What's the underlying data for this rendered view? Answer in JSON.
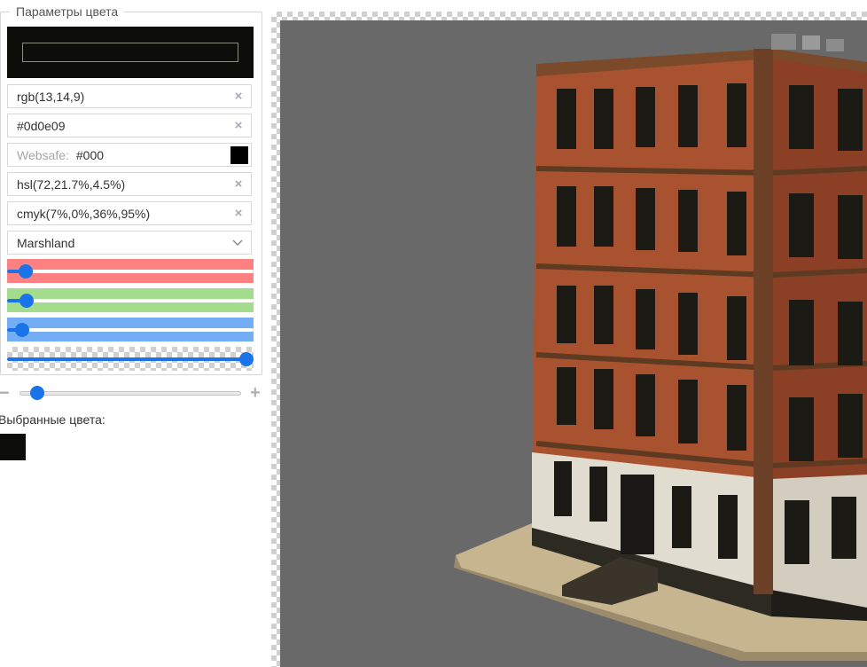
{
  "panel": {
    "legend": "Параметры цвета",
    "preview_color": "#0d0e09",
    "fields": {
      "rgb": "rgb(13,14,9)",
      "hex": "#0d0e09",
      "websafe_label": "Websafe:",
      "websafe_value": "#000",
      "websafe_color": "#000000",
      "hsl": "hsl(72,21.7%,4.5%)",
      "cmyk": "cmyk(7%,0%,36%,95%)",
      "name": "Marshland"
    },
    "clear_glyph": "×",
    "chevron_glyph": "⌵",
    "sliders": {
      "red": {
        "value": 13,
        "max": 255,
        "color": "#ff8080"
      },
      "green": {
        "value": 14,
        "max": 255,
        "color": "#a3dc8d"
      },
      "blue": {
        "value": 9,
        "max": 255,
        "color": "#73aef5"
      },
      "alpha": {
        "value": 1,
        "max": 1
      }
    }
  },
  "zoom": {
    "minus": "−",
    "plus": "+",
    "value": 0.05
  },
  "chosen": {
    "label": "Выбранные цвета:",
    "colors": [
      "#0d0e09"
    ]
  },
  "canvas": {
    "background": "#696969"
  }
}
